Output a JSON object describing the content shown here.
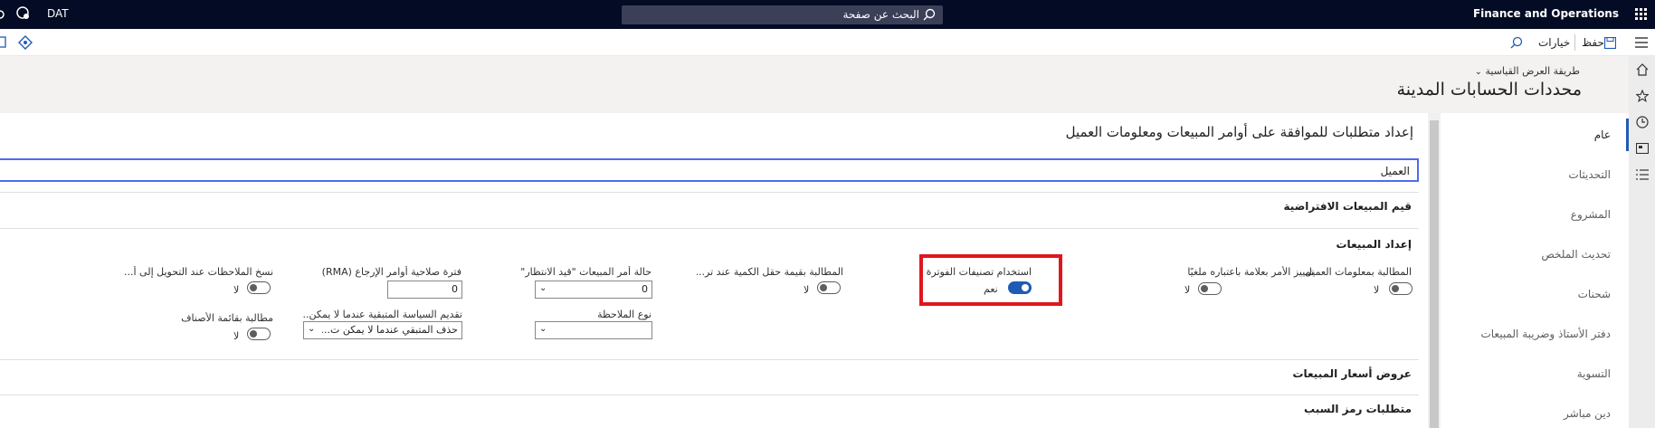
{
  "topbar": {
    "app_title": "Finance and Operations",
    "company": "DAT",
    "search_placeholder": "البحث عن صفحة"
  },
  "actionbar": {
    "save_label": "حفظ",
    "options_label": "خيارات"
  },
  "header": {
    "view_label": "طريقة العرض القياسية",
    "page_title": "محددات الحسابات المدينة"
  },
  "nav": {
    "items": [
      {
        "label": "عام",
        "active": true
      },
      {
        "label": "التحديثات"
      },
      {
        "label": "المشروع"
      },
      {
        "label": "تحديث الملخص"
      },
      {
        "label": "شحنات"
      },
      {
        "label": "دفتر الأستاذ وضريبة المبيعات"
      },
      {
        "label": "التسوية"
      },
      {
        "label": "دين مباشر"
      }
    ]
  },
  "main": {
    "section_title": "إعداد متطلبات للموافقة على أوامر المبيعات ومعلومات العميل",
    "customer_tab": "العميل",
    "default_sales_values": "قيم المبيعات الافتراضية",
    "sales_setup": "إعداد المبيعات",
    "sales_price_offers": "عروض أسعار المبيعات",
    "reason_code_requirements": "متطلبات رمز السبب",
    "fields": {
      "require_customer_info": {
        "label": "المطالبة بمعلومات العميل",
        "value": "لا"
      },
      "mark_order_cancelled": {
        "label": "تمييز الأمر بعلامة باعتباره ملغيًا",
        "value": "لا"
      },
      "use_invoice_categories": {
        "label": "استخدام تصنيفات الفوترة",
        "value": "نعم"
      },
      "require_quantity_value": {
        "label": "المطالبة بقيمة حقل الكمية عند تر...",
        "value": "لا"
      },
      "sales_order_status_pending": {
        "label": "حالة أمر المبيعات \"قيد الانتظار\"",
        "value": "0"
      },
      "note_type": {
        "label": "نوع الملاحظة",
        "value": ""
      },
      "rma_validity_period": {
        "label": "فترة صلاحية أوامر الإرجاع (RMA)",
        "value": "0"
      },
      "remaining_policy": {
        "label": "تقديم السياسة المتبقية عندما لا يمكن...",
        "value": "حذف المتبقي عندما لا يمكن ت..."
      },
      "copy_notes": {
        "label": "نسخ الملاحظات عند التحويل إلى أ...",
        "value": "لا"
      },
      "require_item_list": {
        "label": "مطالبة بقائمة الأصناف",
        "value": "لا"
      }
    }
  },
  "colors": {
    "topbar_bg": "#040b24",
    "accent": "#1f5bb5",
    "highlight_border": "#e0161e"
  }
}
